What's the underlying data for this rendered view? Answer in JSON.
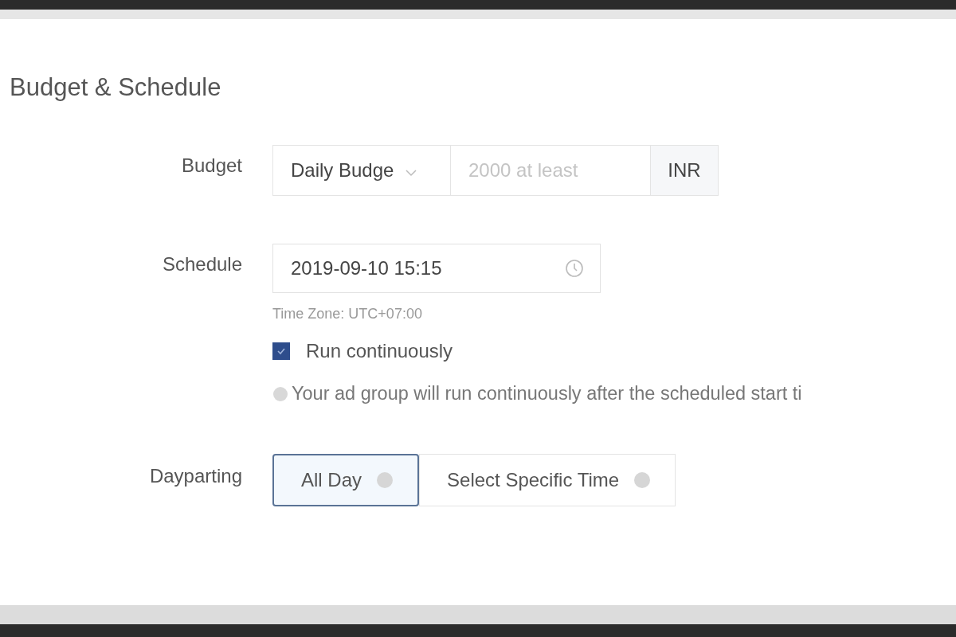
{
  "section": {
    "title": "Budget & Schedule"
  },
  "budget": {
    "label": "Budget",
    "type_value": "Daily Budge",
    "amount_placeholder": "2000 at least",
    "currency": "INR"
  },
  "schedule": {
    "label": "Schedule",
    "value": "2019-09-10 15:15",
    "time_zone": "Time Zone: UTC+07:00",
    "run_continuously": {
      "label": "Run continuously",
      "checked": true
    },
    "hint": "Your ad group will run continuously after the scheduled start ti"
  },
  "dayparting": {
    "label": "Dayparting",
    "options": [
      {
        "label": "All Day",
        "selected": true
      },
      {
        "label": "Select Specific Time",
        "selected": false
      }
    ]
  }
}
